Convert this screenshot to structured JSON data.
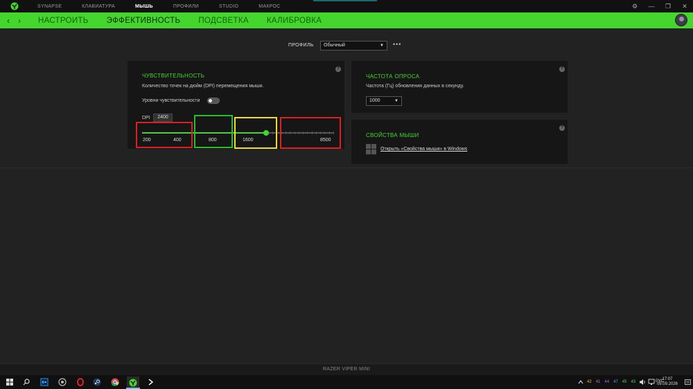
{
  "window": {
    "top_nav": [
      "SYNAPSE",
      "КЛАВИАТУРА",
      "МЫШЬ",
      "ПРОФИЛИ",
      "STUDIO",
      "МАКРОС"
    ],
    "active_top": "МЫШЬ",
    "controls": {
      "settings": "⚙",
      "minimize": "—",
      "maximize": "❐",
      "close": "✕"
    }
  },
  "subnav": {
    "items": [
      "НАСТРОИТЬ",
      "ЭФФЕКТИВНОСТЬ",
      "ПОДСВЕТКА",
      "КАЛИБРОВКА"
    ],
    "active": "ЭФФЕКТИВНОСТЬ"
  },
  "profile": {
    "label": "ПРОФИЛЬ",
    "value": "Обычный",
    "more": "•••"
  },
  "sensitivity": {
    "title": "ЧУВСТВИТЕЛЬНОСТЬ",
    "description": "Количество точек на дюйм (DPI) перемещения мыши.",
    "stages_label": "Уровни чувствительности",
    "stages_enabled": false,
    "dpi_label": "DPI",
    "dpi_value": "2400",
    "stage_labels": [
      "200",
      "400",
      "800",
      "1600",
      "8500"
    ],
    "slider_fraction": 0.65,
    "help": "?"
  },
  "polling": {
    "title": "ЧАСТОТА ОПРОСА",
    "description": "Частота (Гц) обновления данных в секунду.",
    "value": "1000",
    "help": "?"
  },
  "mouse_props": {
    "title": "СВОЙСТВА МЫШИ",
    "link": "Открыть «Свойства мыши» в Windows",
    "help": "?"
  },
  "device_name": "RAZER VIPER MINI",
  "taskbar": {
    "tray_values": [
      "42",
      "41",
      "44",
      "47",
      "45",
      "43"
    ],
    "tray_colors": [
      "#e0c33a",
      "#d060d0",
      "#9f6ee0",
      "#4aa3e0",
      "#4ad07a",
      "#60d060"
    ],
    "language": "РУС",
    "time": "17:07",
    "date": "09.09.2026"
  },
  "colors": {
    "accent": "#44d62c",
    "highlight_red": "#e02020",
    "highlight_green": "#22c02a",
    "highlight_yellow": "#f0e020"
  }
}
